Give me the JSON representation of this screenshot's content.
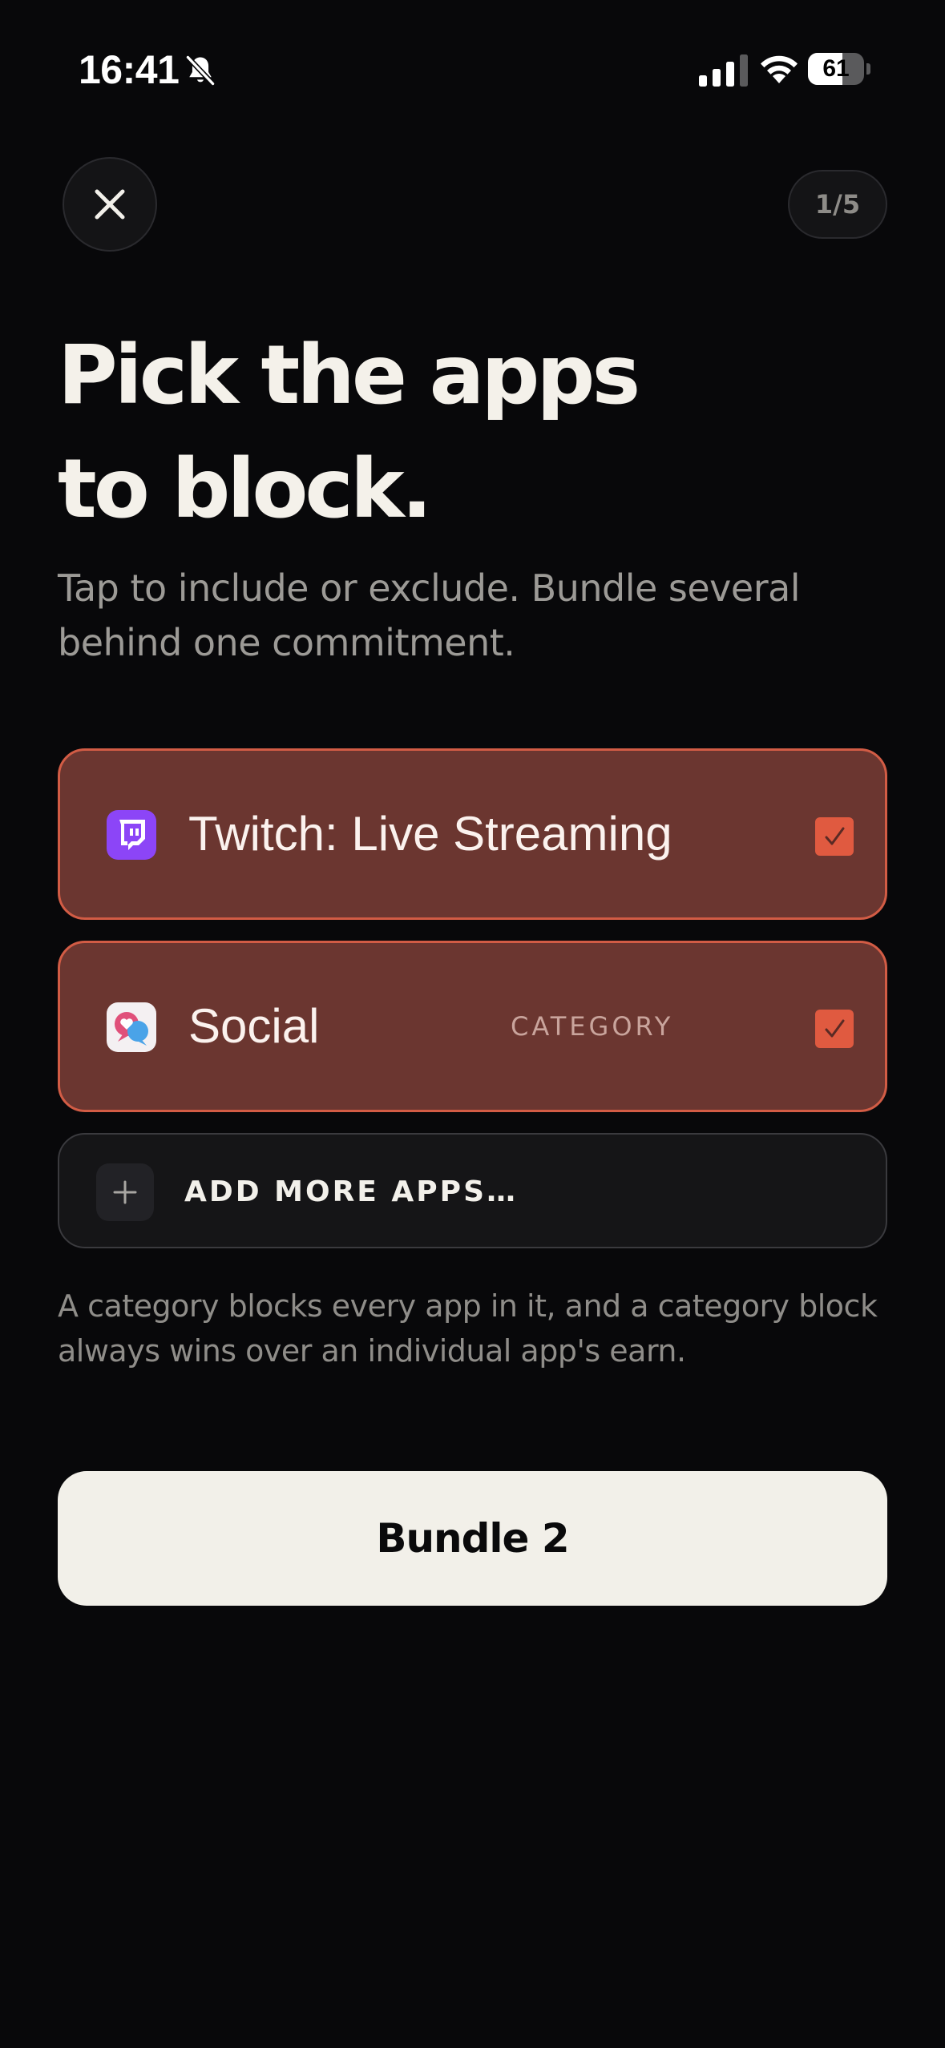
{
  "status_bar": {
    "time": "16:41",
    "silent_icon": "bell-slash-icon",
    "signal_icon": "cellular-signal-icon",
    "wifi_icon": "wifi-icon",
    "battery_level": "61"
  },
  "header": {
    "close_icon": "close-icon",
    "step_indicator": "1/5"
  },
  "headline": {
    "line1": "Pick the apps",
    "line2": "to block."
  },
  "subtitle": "Tap to include or exclude. Bundle several behind one commitment.",
  "apps": [
    {
      "name": "Twitch: Live Streaming",
      "icon": "twitch-icon",
      "selected": true
    },
    {
      "name": "Social",
      "tag": "CATEGORY",
      "icon": "social-category-icon",
      "selected": true
    }
  ],
  "add_more": {
    "icon": "plus-icon",
    "label": "ADD MORE APPS…"
  },
  "note": "A category blocks every app in it, and a category block always wins over an individual app's earn.",
  "primary_button": {
    "label": "Bundle 2"
  },
  "colors": {
    "background": "#08080a",
    "selected_row_bg": "#6b3630",
    "selected_row_border": "#d25c45",
    "checkbox": "#e05a40",
    "primary_button_bg": "#f2f0e9",
    "headline": "#f4f1ea"
  }
}
